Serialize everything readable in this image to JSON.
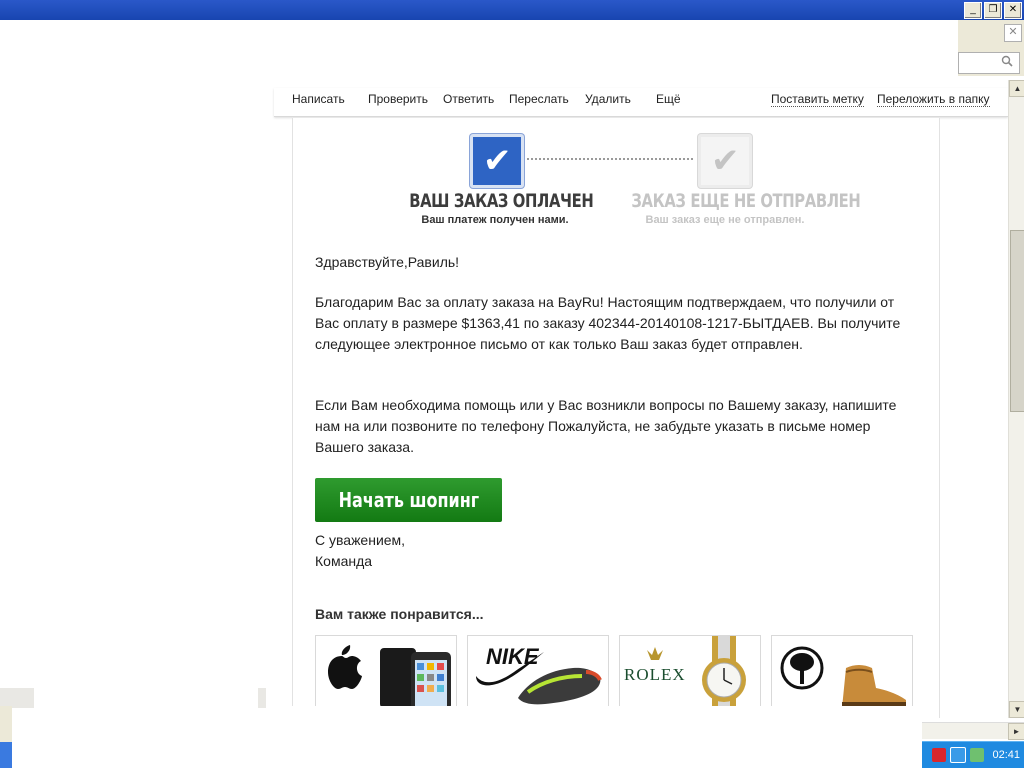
{
  "colors": {
    "accent_blue": "#2e64c4",
    "button_green": "#1c861c",
    "taskbar_blue": "#1f8ae0"
  },
  "window": {
    "minimize_glyph": "_",
    "maximize_glyph": "❐",
    "close_glyph": "✕",
    "tab_close_glyph": "✕",
    "search_icon": "search-icon"
  },
  "toolbar": {
    "write": "Написать",
    "check": "Проверить",
    "reply": "Ответить",
    "forward": "Переслать",
    "delete": "Удалить",
    "more": "Ещё",
    "set_label": "Поставить метку",
    "move_to_folder": "Переложить в папку"
  },
  "steps": [
    {
      "title": "ВАШ ЗАКАЗ ОПЛАЧЕН",
      "subtitle": "Ваш платеж получен нами.",
      "state": "done"
    },
    {
      "title": "ЗАКАЗ ЕЩЕ НЕ ОТПРАВЛЕН",
      "subtitle": "Ваш заказ еще не отправлен.",
      "state": "pending"
    }
  ],
  "email": {
    "greeting": "Здравствуйте,Равиль!",
    "para1": "Благодарим Вас за оплату заказа на BayRu! Настоящим подтверждаем, что получили от Вас оплату в размере $1363,41 по заказу 402344-20140108-1217-БЫТДАЕВ. Вы получите следующее электронное письмо от            как только Ваш заказ будет отправлен.",
    "para2": "Если Вам необходима помощь или у Вас возникли вопросы по Вашему заказу, напишите нам на                      или позвоните по телефону                              Пожалуйста, не забудьте указать в письме номер Вашего заказа.",
    "shop_button": "Начать шопинг",
    "regards": "С уважением,",
    "team": "Команда",
    "also_like": "Вам также понравится..."
  },
  "products": [
    {
      "brand": "apple",
      "icon": "apple-logo-icon"
    },
    {
      "brand": "NIKE",
      "icon": "nike-swoosh-icon"
    },
    {
      "brand": "ROLEX",
      "icon": "crown-icon"
    },
    {
      "brand": "timberland",
      "icon": "tree-icon"
    }
  ],
  "tray": {
    "clock": "02:41",
    "icons": [
      "antivirus-icon",
      "network-icon",
      "volume-icon"
    ]
  }
}
